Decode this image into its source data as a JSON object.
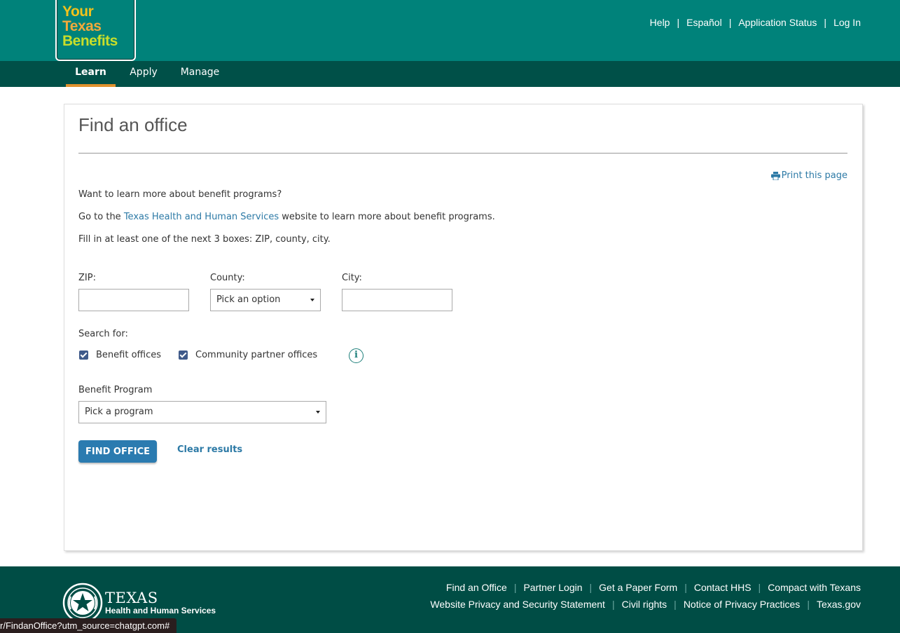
{
  "header": {
    "logo": {
      "line1": "Your",
      "line2": "Texas",
      "line3": "Benefits"
    },
    "util_links": [
      "Help",
      "Español",
      "Application Status",
      "Log In"
    ],
    "separator": "|",
    "tabs": [
      "Learn",
      "Apply",
      "Manage"
    ],
    "active_tab": "Learn"
  },
  "main": {
    "title": "Find an office",
    "print_link": "Print this page",
    "intro": "Want to learn more about benefit programs?",
    "goto_pre": "Go to the ",
    "goto_link": "Texas Health and Human Services",
    "goto_post": " website to learn more about benefit programs.",
    "instructions": "Fill in at least one of the next 3 boxes: ZIP, county, city.",
    "zip_label": "ZIP:",
    "zip_value": "",
    "county_label": "County:",
    "county_selected": "Pick an option",
    "city_label": "City:",
    "city_value": "",
    "search_for_label": "Search for:",
    "checkboxes": [
      {
        "label": "Benefit offices",
        "checked": true
      },
      {
        "label": "Community partner offices",
        "checked": true
      }
    ],
    "info_symbol": "i",
    "benefit_program_label": "Benefit Program",
    "benefit_program_selected": "Pick a program",
    "find_button": "FIND OFFICE",
    "clear_link": "Clear results"
  },
  "footer": {
    "org_line1": "TEXAS",
    "org_line2": "Health and Human Services",
    "links_row1": [
      "Find an Office",
      "Partner Login",
      "Get a Paper Form",
      "Contact HHS",
      "Compact with Texans"
    ],
    "links_row2": [
      "Website Privacy and Security Statement",
      "Civil rights",
      "Notice of Privacy Practices",
      "Texas.gov"
    ],
    "separator": "|"
  },
  "status_bar": {
    "url": "r/FindanOffice?utm_source=chatgpt.com#"
  },
  "colors": {
    "header_teal": "#00827a",
    "nav_dark": "#005048",
    "footer_dark": "#004d45",
    "link_blue": "#2d7aa6",
    "button_blue": "#2b7bb0",
    "active_tab_underline": "#e0912e",
    "checkbox": "#3f5a8a"
  },
  "icons": [
    "printer-icon",
    "info-icon",
    "dropdown-caret-icon",
    "checkmark-icon",
    "texas-hhs-seal"
  ]
}
